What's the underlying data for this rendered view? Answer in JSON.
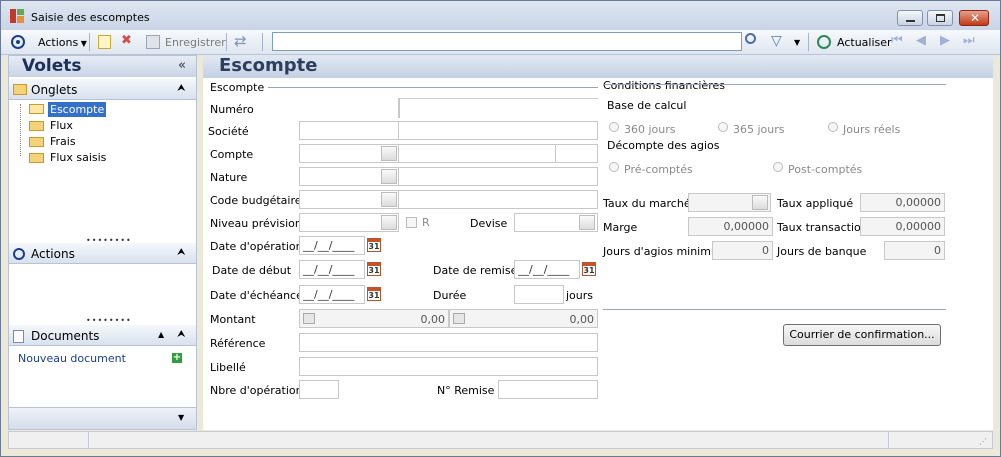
{
  "window": {
    "title": "Saisie des escomptes"
  },
  "toolbar": {
    "actions": "Actions",
    "save": "Enregistrer",
    "refresh": "Actualiser",
    "search_value": ""
  },
  "left": {
    "title": "Volets",
    "tabs_title": "Onglets",
    "tabs": [
      "Escompte",
      "Flux",
      "Frais",
      "Flux saisis"
    ],
    "actions_title": "Actions",
    "documents_title": "Documents",
    "new_document": "Nouveau document"
  },
  "main": {
    "title": "Escompte",
    "group_escompte": "Escompte",
    "group_conditions": "Conditions financières",
    "labels": {
      "numero": "Numéro",
      "societe": "Société",
      "compte": "Compte",
      "nature": "Nature",
      "code_budgetaire": "Code budgétaire",
      "niveau_prevision": "Niveau prévision",
      "r": "R",
      "devise": "Devise",
      "date_operation": "Date d'opération",
      "date_debut": "Date de début",
      "date_remise": "Date de remise",
      "date_echeance": "Date d'échéance",
      "duree": "Durée",
      "jours": "jours",
      "montant": "Montant",
      "reference": "Référence",
      "libelle": "Libellé",
      "nbre_operations": "Nbre d'opérations",
      "n_remise": "N° Remise"
    },
    "date_placeholder": "__/__/____",
    "cal_label": "31",
    "montant_1": "0,00",
    "montant_2": "0,00",
    "cond": {
      "base_calcul": "Base de calcul",
      "b360": "360 jours",
      "b365": "365 jours",
      "reels": "Jours réels",
      "decompte": "Décompte des agios",
      "precomptes": "Pré-comptés",
      "postcomptes": "Post-comptés",
      "taux_marche": "Taux du marché",
      "taux_applique": "Taux appliqué",
      "taux_applique_val": "0,00000",
      "marge": "Marge",
      "marge_val": "0,00000",
      "taux_transaction": "Taux transaction",
      "taux_transaction_val": "0,00000",
      "jours_min": "Jours d'agios minimum",
      "jours_min_val": "0",
      "jours_banque": "Jours de banque",
      "jours_banque_val": "0",
      "courrier": "Courrier de confirmation..."
    }
  },
  "colors": {
    "accent": "#1d3f8a",
    "selection": "#3370cc"
  }
}
